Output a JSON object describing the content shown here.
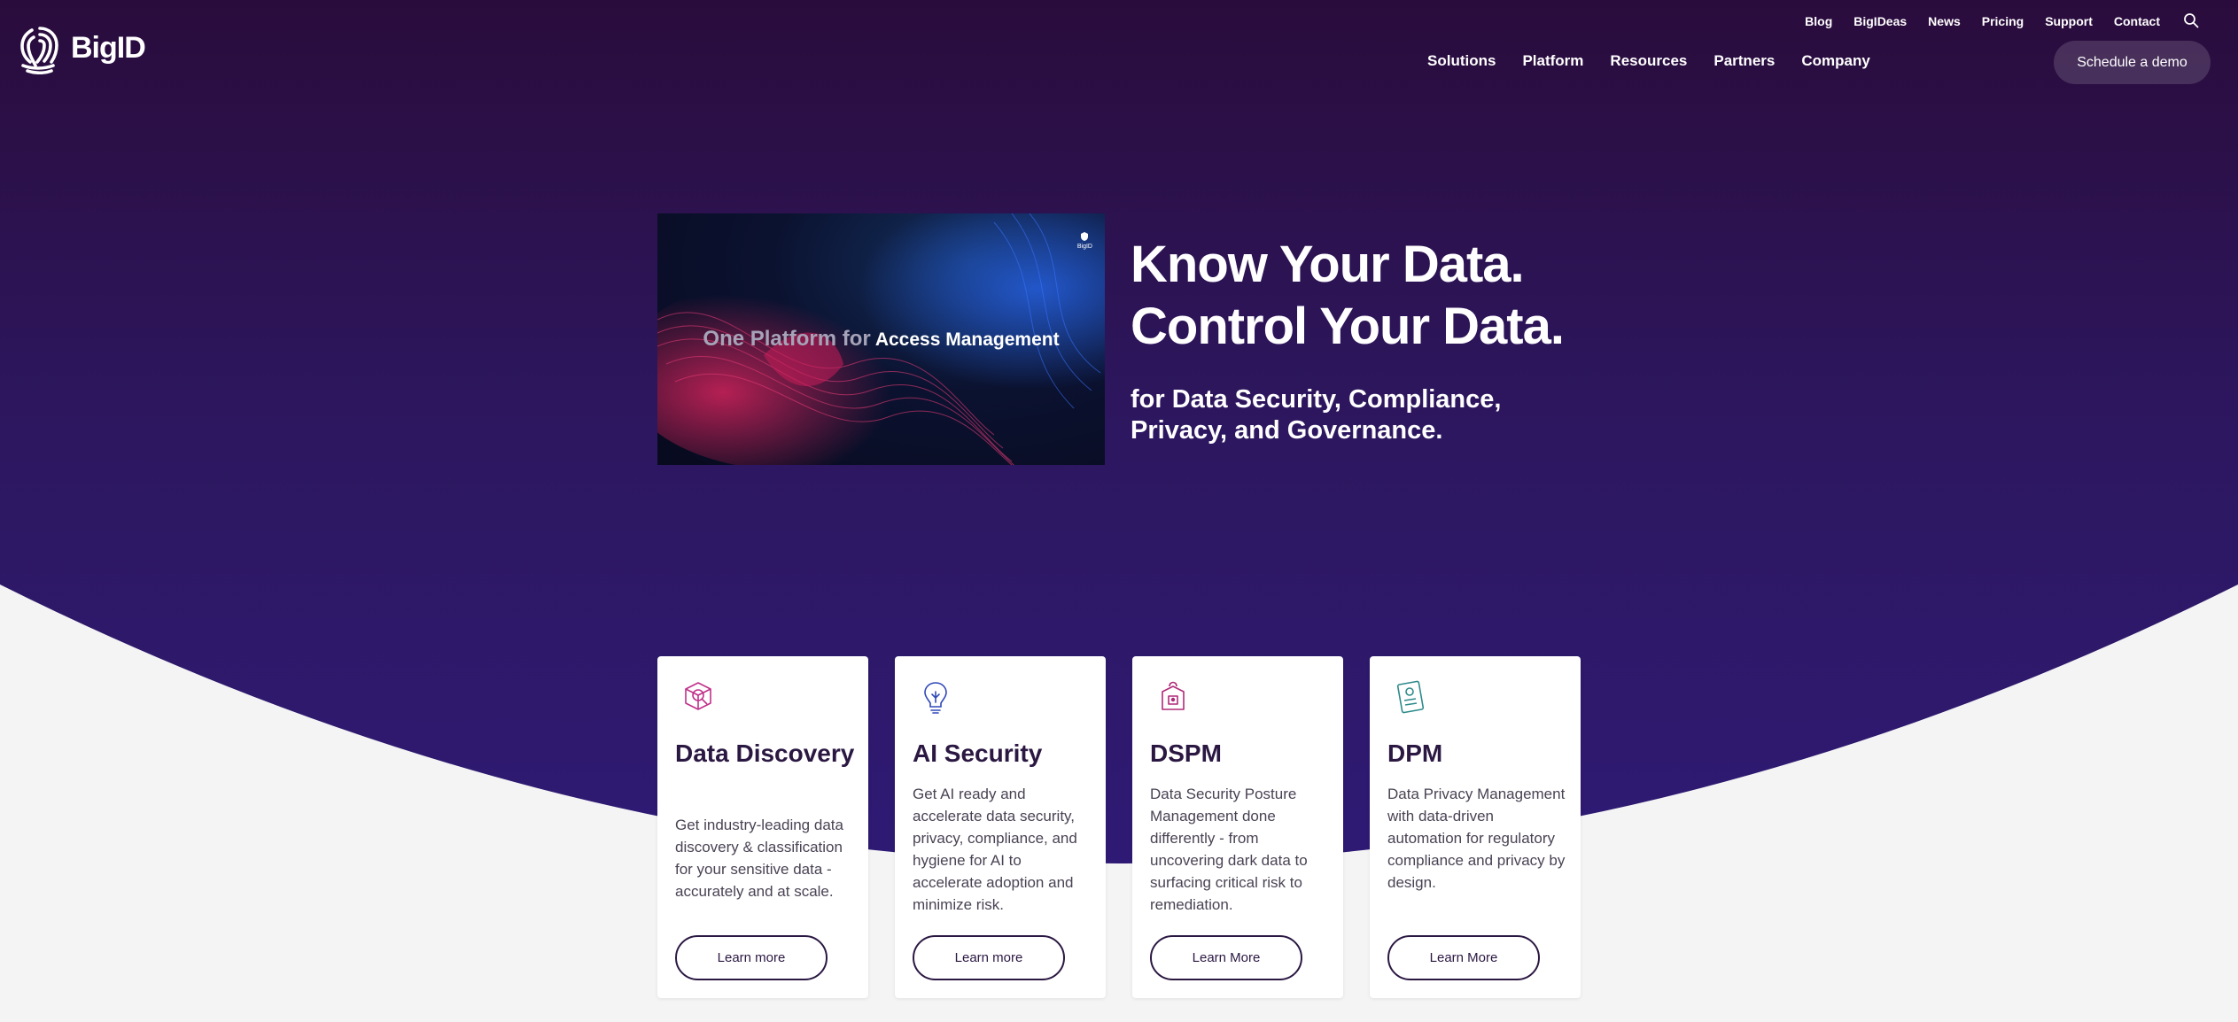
{
  "brand": {
    "name": "BigID"
  },
  "util_nav": [
    "Blog",
    "BigIDeas",
    "News",
    "Pricing",
    "Support",
    "Contact"
  ],
  "main_nav": [
    "Solutions",
    "Platform",
    "Resources",
    "Partners",
    "Company"
  ],
  "header": {
    "cta": "Schedule a demo"
  },
  "hero": {
    "video_caption_prefix": "One Platform for",
    "video_caption_highlight": "Access Management",
    "video_logo": "BigID",
    "title_line1": "Know Your Data.",
    "title_line2": "Control Your Data.",
    "subtitle": "for Data Security, Compliance, Privacy, and Governance."
  },
  "cards": [
    {
      "icon": "cube-icon",
      "title": "Data Discovery",
      "desc": "Get industry-leading data discovery & classification for your sensitive data - accurately and at scale.",
      "cta": "Learn more"
    },
    {
      "icon": "lightbulb-icon",
      "title": "AI Security",
      "desc": "Get AI ready and accelerate data security, privacy, compliance, and hygiene for AI to accelerate adoption and minimize risk.",
      "cta": "Learn more"
    },
    {
      "icon": "lock-box-icon",
      "title": "DSPM",
      "desc": "Data Security Posture Management done differently - from uncovering dark data to surfacing critical risk to remediation.",
      "cta": "Learn More"
    },
    {
      "icon": "id-card-icon",
      "title": "DPM",
      "desc": "Data Privacy Management with data-driven automation for regulatory compliance and privacy by design.",
      "cta": "Learn More"
    }
  ],
  "colors": {
    "hero_top": "#2a0c3c",
    "hero_bottom": "#2e1a72",
    "page_bg": "#f4f4f5",
    "heading": "#2b1842"
  }
}
